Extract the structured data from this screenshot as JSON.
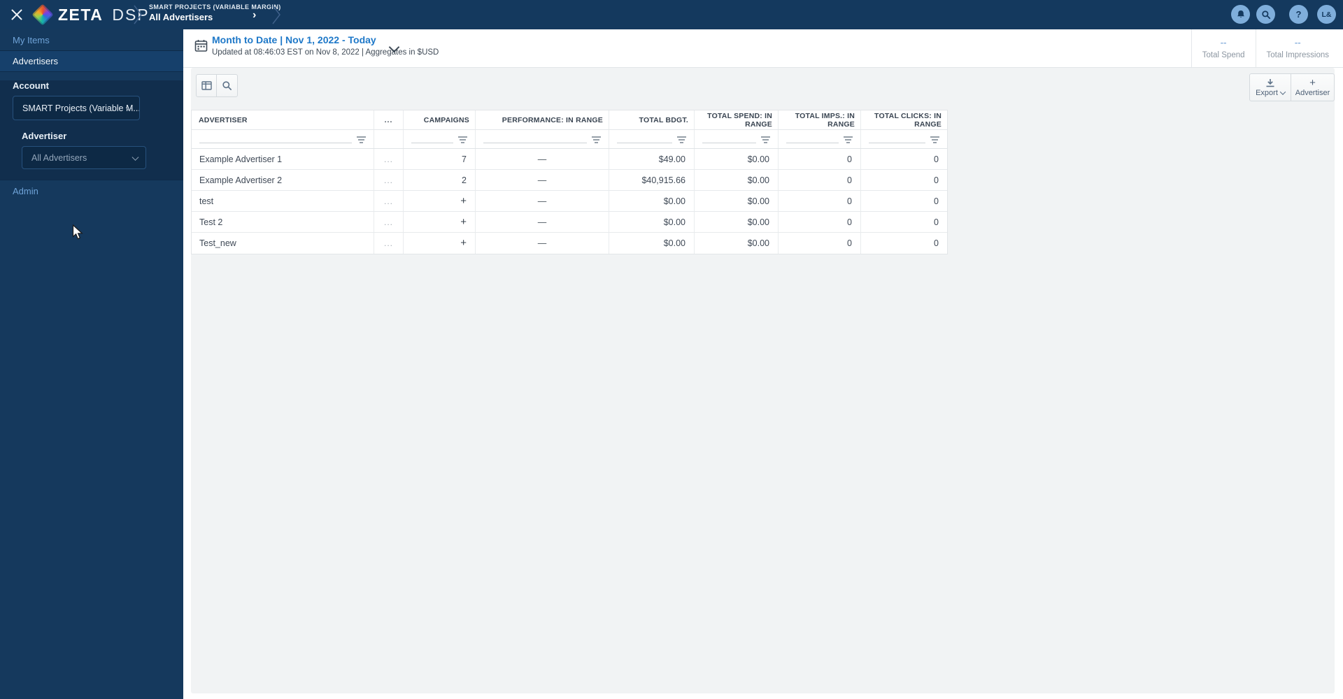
{
  "topbar": {
    "brand_name": "ZETA",
    "brand_suffix": "DSP",
    "breadcrumb_account": "SMART PROJECTS (VARIABLE MARGIN)",
    "breadcrumb_page": "All Advertisers",
    "help_label": "?",
    "avatar_initials": "L&"
  },
  "sidebar": {
    "my_items": "My Items",
    "advertisers": "Advertisers",
    "account_label": "Account",
    "account_value": "SMART Projects (Variable M...",
    "advertiser_label": "Advertiser",
    "advertiser_value": "All Advertisers",
    "admin": "Admin"
  },
  "datebar": {
    "title": "Month to Date | Nov 1, 2022 - Today",
    "subtitle": "Updated at 08:46:03 EST on Nov 8, 2022 | Aggregates in $USD"
  },
  "stats": [
    {
      "value": "--",
      "label": "Total Spend"
    },
    {
      "value": "--",
      "label": "Total Impressions"
    }
  ],
  "actions": {
    "export_label": "Export",
    "add_advertiser_label": "Advertiser"
  },
  "table": {
    "columns": [
      "ADVERTISER",
      "...",
      "CAMPAIGNS",
      "PERFORMANCE: IN RANGE",
      "TOTAL BDGT.",
      "TOTAL SPEND: IN RANGE",
      "TOTAL IMPS.: IN RANGE",
      "TOTAL CLICKS: IN RANGE"
    ],
    "row_menu": "...",
    "rows": [
      {
        "name": "Example Advertiser 1",
        "campaigns": "7",
        "performance": "—",
        "budget": "$49.00",
        "spend": "$0.00",
        "imps": "0",
        "clicks": "0"
      },
      {
        "name": "Example Advertiser 2",
        "campaigns": "2",
        "performance": "—",
        "budget": "$40,915.66",
        "spend": "$0.00",
        "imps": "0",
        "clicks": "0"
      },
      {
        "name": "test",
        "campaigns": "+",
        "performance": "—",
        "budget": "$0.00",
        "spend": "$0.00",
        "imps": "0",
        "clicks": "0"
      },
      {
        "name": "Test 2",
        "campaigns": "+",
        "performance": "—",
        "budget": "$0.00",
        "spend": "$0.00",
        "imps": "0",
        "clicks": "0"
      },
      {
        "name": "Test_new",
        "campaigns": "+",
        "performance": "—",
        "budget": "$0.00",
        "spend": "$0.00",
        "imps": "0",
        "clicks": "0"
      }
    ]
  },
  "colors": {
    "navy": "#14395E",
    "accent_blue": "#1E78C8",
    "light_blue_button": "#7FAEDB",
    "panel_grey": "#F1F3F4"
  }
}
